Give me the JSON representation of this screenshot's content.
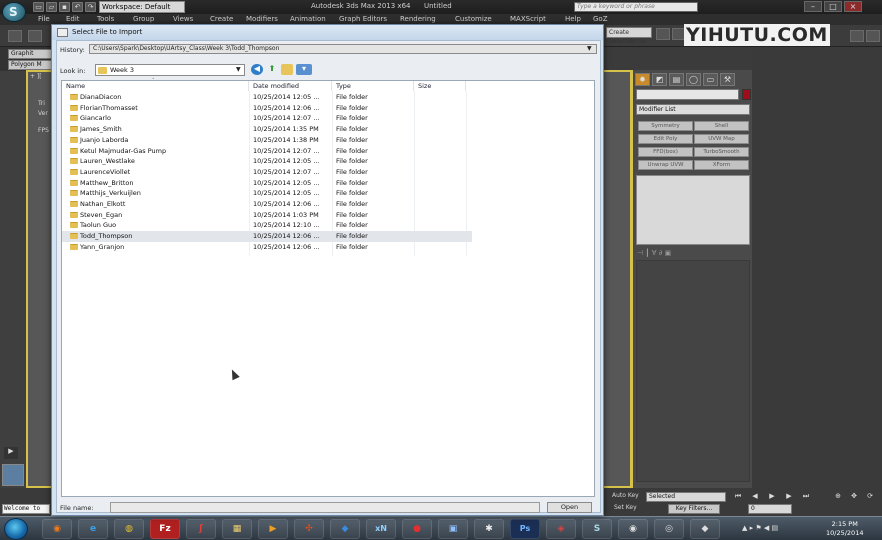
{
  "app": {
    "title": "Autodesk 3ds Max  2013 x64",
    "document": "Untitled",
    "workspace": "Workspace: Default",
    "search_placeholder": "Type a keyword or phrase",
    "selection_set": "Create Selection Se",
    "window_controls": [
      "–",
      "□",
      "×"
    ]
  },
  "menu": [
    "File",
    "Edit",
    "Tools",
    "Group",
    "Views",
    "Create",
    "Modifiers",
    "Animation",
    "Graph Editors",
    "Rendering",
    "Customize",
    "MAXScript",
    "Help",
    "GoZ"
  ],
  "ribbon": {
    "tab1": "Graphit",
    "tab2": "Polygon M"
  },
  "watermark": "YIHUTU.COM",
  "viewport": {
    "label": "+ ][",
    "stats_lines": [
      "Tri",
      "Ver",
      "FPS"
    ]
  },
  "command_panel": {
    "modifier_list": "Modifier List",
    "buttons": [
      "Symmetry",
      "Shell",
      "Edit Poly",
      "UVW Map",
      "FFD(box)",
      "TurboSmooth",
      "Unwrap UVW",
      "XForm"
    ]
  },
  "dialog": {
    "title": "Select File to Import",
    "history_label": "History:",
    "history_path": "C:\\Users\\Spark\\Desktop\\UArtsy_Class\\Week 3\\Todd_Thompson",
    "lookin_label": "Look in:",
    "lookin_value": "Week 3",
    "columns": [
      "Name",
      "Date modified",
      "Type",
      "Size"
    ],
    "rows": [
      {
        "name": "DianaDiacon",
        "date": "10/25/2014 12:05 ...",
        "type": "File folder"
      },
      {
        "name": "FlorianThomasset",
        "date": "10/25/2014 12:06 ...",
        "type": "File folder"
      },
      {
        "name": "Giancarlo",
        "date": "10/25/2014 12:07 ...",
        "type": "File folder"
      },
      {
        "name": "James_Smith",
        "date": "10/25/2014 1:35 PM",
        "type": "File folder"
      },
      {
        "name": "Juanjo Laborda",
        "date": "10/25/2014 1:38 PM",
        "type": "File folder"
      },
      {
        "name": "Ketul Majmudar-Gas Pump",
        "date": "10/25/2014 12:07 ...",
        "type": "File folder"
      },
      {
        "name": "Lauren_Westlake",
        "date": "10/25/2014 12:05 ...",
        "type": "File folder"
      },
      {
        "name": "LaurenceViollet",
        "date": "10/25/2014 12:07 ...",
        "type": "File folder"
      },
      {
        "name": "Matthew_Britton",
        "date": "10/25/2014 12:05 ...",
        "type": "File folder"
      },
      {
        "name": "Matthijs_Verkuijlen",
        "date": "10/25/2014 12:05 ...",
        "type": "File folder"
      },
      {
        "name": "Nathan_Elkott",
        "date": "10/25/2014 12:06 ...",
        "type": "File folder"
      },
      {
        "name": "Steven_Egan",
        "date": "10/25/2014 1:03 PM",
        "type": "File folder"
      },
      {
        "name": "Taolun Guo",
        "date": "10/25/2014 12:10 ...",
        "type": "File folder"
      },
      {
        "name": "Todd_Thompson",
        "date": "10/25/2014 12:06 ...",
        "type": "File folder",
        "selected": true
      },
      {
        "name": "Yann_Granjon",
        "date": "10/25/2014 12:06 ...",
        "type": "File folder"
      }
    ],
    "filename_label": "File name:",
    "filename_value": "",
    "open_label": "Open"
  },
  "status": {
    "maxscript_listener": "Welcome to",
    "auto_key": "Auto Key",
    "set_key": "Set Key",
    "selected_dropdown": "Selected",
    "key_filters": "Key Filters...",
    "frame": "0"
  },
  "taskbar": {
    "apps": [
      "Firefox",
      "Internet Explorer",
      "Chrome",
      "FileZilla",
      "App",
      "Explorer",
      "Media",
      "App",
      "Dropbox",
      "xN",
      "App",
      "Screen",
      "Daz",
      "Photoshop",
      "App",
      "3ds Max",
      "Camera"
    ],
    "time": "2:15 PM",
    "date": "10/25/2014"
  }
}
